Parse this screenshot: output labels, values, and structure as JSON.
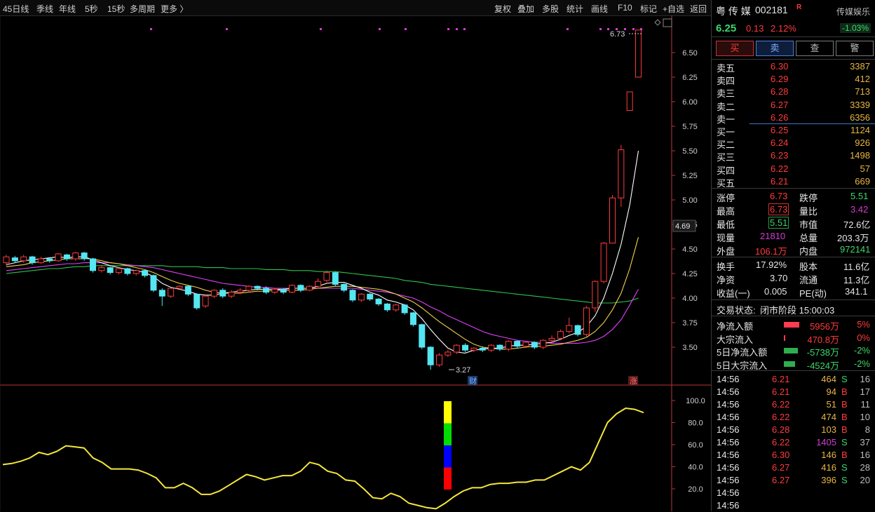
{
  "toolbar": {
    "left_items": [
      "45日线",
      "季线",
      "年线",
      "5秒",
      "15秒",
      "多周期",
      "更多 〉"
    ],
    "right_items": [
      "复权",
      "叠加",
      "多股",
      "统计",
      "画线",
      "F10",
      "标记",
      "+自选",
      "返回"
    ]
  },
  "stock": {
    "name": "粤 传 媒",
    "code": "002181",
    "badge": "R",
    "sector": "传媒娱乐",
    "sector_change": "-1.03%",
    "price": "6.25",
    "change": "0.13",
    "change_pct": "2.12%"
  },
  "trade_buttons": [
    "买",
    "卖",
    "查",
    "警"
  ],
  "orderbook": {
    "asks": [
      {
        "label": "卖五",
        "price": "6.30",
        "vol": "3387"
      },
      {
        "label": "卖四",
        "price": "6.29",
        "vol": "412"
      },
      {
        "label": "卖三",
        "price": "6.28",
        "vol": "713"
      },
      {
        "label": "卖二",
        "price": "6.27",
        "vol": "3339"
      },
      {
        "label": "卖一",
        "price": "6.26",
        "vol": "6356"
      }
    ],
    "bids": [
      {
        "label": "买一",
        "price": "6.25",
        "vol": "1124"
      },
      {
        "label": "买二",
        "price": "6.24",
        "vol": "926"
      },
      {
        "label": "买三",
        "price": "6.23",
        "vol": "1498"
      },
      {
        "label": "买四",
        "price": "6.22",
        "vol": "57"
      },
      {
        "label": "买五",
        "price": "6.21",
        "vol": "669"
      }
    ]
  },
  "stats": {
    "limit_up_l": "涨停",
    "limit_up_v": "6.73",
    "limit_down_l": "跌停",
    "limit_down_v": "5.51",
    "high_l": "最高",
    "high_v": "6.73",
    "vol_ratio_l": "量比",
    "vol_ratio_v": "3.42",
    "low_l": "最低",
    "low_v": "5.51",
    "mcap_l": "市值",
    "mcap_v": "72.6亿",
    "cur_l": "现量",
    "cur_v": "21810",
    "total_l": "总量",
    "total_v": "203.3万",
    "outer_l": "外盘",
    "outer_v": "106.1万",
    "inner_l": "内盘",
    "inner_v": "972141",
    "turnover_l": "换手",
    "turnover_v": "17.92%",
    "share_l": "股本",
    "share_v": "11.6亿",
    "nav_l": "净资",
    "nav_v": "3.70",
    "float_l": "流通",
    "float_v": "11.3亿",
    "eps_l": "收益(一)",
    "eps_v": "0.005",
    "pe_l": "PE(动)",
    "pe_v": "341.1"
  },
  "status": {
    "label": "交易状态:",
    "value": "闭市阶段 15:00:03"
  },
  "flows": [
    {
      "label": "净流入额",
      "value": "5956万",
      "pct": "5%",
      "color": "#ff3b50",
      "bar": 0.6,
      "dir": "pos"
    },
    {
      "label": "大宗流入",
      "value": "470.8万",
      "pct": "0%",
      "color": "#ff3b50",
      "bar": 0.05,
      "dir": "pos"
    },
    {
      "label": "5日净流入额",
      "value": "-5738万",
      "pct": "-2%",
      "color": "#2fae4e",
      "bar": 0.55,
      "dir": "neg"
    },
    {
      "label": "5日大宗流入",
      "value": "-4524万",
      "pct": "-2%",
      "color": "#2fae4e",
      "bar": 0.45,
      "dir": "neg"
    }
  ],
  "ticks": [
    {
      "time": "14:56",
      "price": "6.21",
      "vol": "464",
      "side": "S",
      "n": "16"
    },
    {
      "time": "14:56",
      "price": "6.21",
      "vol": "94",
      "side": "B",
      "n": "17"
    },
    {
      "time": "14:56",
      "price": "6.22",
      "vol": "51",
      "side": "B",
      "n": "11"
    },
    {
      "time": "14:56",
      "price": "6.22",
      "vol": "474",
      "side": "B",
      "n": "10"
    },
    {
      "time": "14:56",
      "price": "6.28",
      "vol": "103",
      "side": "B",
      "n": "8"
    },
    {
      "time": "14:56",
      "price": "6.22",
      "vol": "1405",
      "side": "S",
      "n": "37"
    },
    {
      "time": "14:56",
      "price": "6.30",
      "vol": "146",
      "side": "B",
      "n": "16"
    },
    {
      "time": "14:56",
      "price": "6.27",
      "vol": "416",
      "side": "S",
      "n": "28"
    },
    {
      "time": "14:56",
      "price": "6.27",
      "vol": "396",
      "side": "S",
      "n": "20"
    },
    {
      "time": "14:56",
      "price": "",
      "vol": "",
      "side": "",
      "n": ""
    },
    {
      "time": "14:56",
      "price": "",
      "vol": "",
      "side": "",
      "n": ""
    }
  ],
  "chart_data": [
    {
      "type": "candlestick",
      "yticks": [
        6.5,
        6.25,
        6.0,
        5.75,
        5.5,
        5.25,
        5.0,
        4.75,
        4.5,
        4.25,
        4.0,
        3.75,
        3.5
      ],
      "current_price_label": "4.69",
      "annotations": {
        "high": "6.73",
        "low": "3.27",
        "cai": "财",
        "zhang": "涨"
      },
      "colors": {
        "up": "#ff3b3b",
        "down": "#54e6f2",
        "ma5": "#ffffff",
        "ma10": "#f2d04b",
        "ma20": "#e040fb",
        "ma60": "#2fc24a"
      },
      "candles": [
        [
          4.36,
          4.42,
          4.33,
          4.44
        ],
        [
          4.41,
          4.38,
          4.36,
          4.43
        ],
        [
          4.38,
          4.42,
          4.36,
          4.44
        ],
        [
          4.42,
          4.36,
          4.34,
          4.43
        ],
        [
          4.36,
          4.4,
          4.35,
          4.42
        ],
        [
          4.4,
          4.38,
          4.36,
          4.41
        ],
        [
          4.38,
          4.45,
          4.37,
          4.46
        ],
        [
          4.44,
          4.4,
          4.38,
          4.45
        ],
        [
          4.4,
          4.46,
          4.38,
          4.47
        ],
        [
          4.46,
          4.4,
          4.38,
          4.47
        ],
        [
          4.4,
          4.28,
          4.26,
          4.41
        ],
        [
          4.28,
          4.31,
          4.26,
          4.33
        ],
        [
          4.31,
          4.26,
          4.24,
          4.32
        ],
        [
          4.26,
          4.3,
          4.24,
          4.31
        ],
        [
          4.3,
          4.25,
          4.23,
          4.31
        ],
        [
          4.25,
          4.28,
          4.23,
          4.29
        ],
        [
          4.28,
          4.23,
          4.21,
          4.29
        ],
        [
          4.23,
          4.08,
          4.06,
          4.24
        ],
        [
          4.08,
          4.02,
          3.92,
          4.1
        ],
        [
          4.02,
          4.1,
          4.0,
          4.11
        ],
        [
          4.1,
          4.12,
          4.08,
          4.13
        ],
        [
          4.12,
          4.04,
          4.02,
          4.13
        ],
        [
          4.04,
          3.9,
          3.88,
          4.05
        ],
        [
          3.92,
          4.02,
          3.9,
          4.04
        ],
        [
          4.02,
          4.08,
          4.0,
          4.09
        ],
        [
          4.08,
          4.02,
          4.0,
          4.1
        ],
        [
          4.02,
          4.06,
          4.0,
          4.08
        ],
        [
          4.06,
          4.08,
          4.04,
          4.1
        ],
        [
          4.08,
          4.12,
          4.06,
          4.13
        ],
        [
          4.12,
          4.1,
          4.08,
          4.13
        ],
        [
          4.1,
          4.06,
          4.04,
          4.12
        ],
        [
          4.06,
          4.09,
          4.04,
          4.1
        ],
        [
          4.09,
          4.06,
          4.04,
          4.1
        ],
        [
          4.06,
          4.13,
          4.05,
          4.14
        ],
        [
          4.13,
          4.08,
          4.06,
          4.14
        ],
        [
          4.08,
          4.12,
          4.07,
          4.13
        ],
        [
          4.12,
          4.17,
          4.1,
          4.2
        ],
        [
          4.18,
          4.26,
          4.16,
          4.28
        ],
        [
          4.26,
          4.14,
          4.12,
          4.27
        ],
        [
          4.14,
          4.08,
          4.06,
          4.15
        ],
        [
          4.08,
          3.98,
          3.96,
          4.09
        ],
        [
          3.98,
          4.04,
          3.96,
          4.05
        ],
        [
          4.04,
          3.99,
          3.97,
          4.05
        ],
        [
          3.99,
          3.94,
          3.92,
          4.0
        ],
        [
          3.94,
          3.88,
          3.86,
          3.95
        ],
        [
          3.88,
          3.93,
          3.86,
          3.94
        ],
        [
          3.93,
          3.85,
          3.83,
          3.94
        ],
        [
          3.85,
          3.73,
          3.71,
          3.86
        ],
        [
          3.73,
          3.5,
          3.48,
          3.74
        ],
        [
          3.5,
          3.32,
          3.27,
          3.51
        ],
        [
          3.32,
          3.42,
          3.3,
          3.44
        ],
        [
          3.42,
          3.45,
          3.4,
          3.47
        ],
        [
          3.45,
          3.52,
          3.43,
          3.53
        ],
        [
          3.52,
          3.47,
          3.45,
          3.54
        ],
        [
          3.47,
          3.49,
          3.45,
          3.5
        ],
        [
          3.49,
          3.47,
          3.45,
          3.51
        ],
        [
          3.47,
          3.52,
          3.45,
          3.53
        ],
        [
          3.52,
          3.48,
          3.46,
          3.53
        ],
        [
          3.48,
          3.56,
          3.46,
          3.57
        ],
        [
          3.56,
          3.51,
          3.49,
          3.57
        ],
        [
          3.51,
          3.55,
          3.49,
          3.56
        ],
        [
          3.55,
          3.5,
          3.48,
          3.56
        ],
        [
          3.5,
          3.57,
          3.48,
          3.58
        ],
        [
          3.57,
          3.59,
          3.55,
          3.62
        ],
        [
          3.59,
          3.66,
          3.57,
          3.68
        ],
        [
          3.66,
          3.72,
          3.64,
          3.8
        ],
        [
          3.72,
          3.63,
          3.61,
          3.73
        ],
        [
          3.63,
          3.9,
          3.6,
          3.92
        ],
        [
          3.9,
          4.17,
          3.86,
          4.18
        ],
        [
          4.17,
          4.56,
          4.15,
          4.57
        ],
        [
          4.56,
          5.02,
          4.82,
          5.05
        ],
        [
          5.02,
          5.51,
          4.93,
          5.56
        ],
        [
          5.91,
          6.1,
          5.91,
          6.1
        ],
        [
          6.25,
          6.73,
          6.25,
          6.73
        ]
      ],
      "ma5": [
        4.34,
        4.36,
        4.38,
        4.39,
        4.4,
        4.41,
        4.42,
        4.41,
        4.42,
        4.42,
        4.39,
        4.36,
        4.33,
        4.31,
        4.29,
        4.28,
        4.26,
        4.22,
        4.15,
        4.11,
        4.09,
        4.07,
        4.04,
        4.03,
        4.03,
        4.05,
        4.06,
        4.07,
        4.08,
        4.09,
        4.09,
        4.09,
        4.09,
        4.1,
        4.1,
        4.1,
        4.12,
        4.15,
        4.16,
        4.16,
        4.13,
        4.1,
        4.06,
        4.03,
        3.98,
        3.96,
        3.93,
        3.88,
        3.79,
        3.68,
        3.58,
        3.49,
        3.45,
        3.44,
        3.47,
        3.48,
        3.49,
        3.49,
        3.51,
        3.52,
        3.52,
        3.53,
        3.54,
        3.55,
        3.58,
        3.62,
        3.65,
        3.71,
        3.82,
        4.0,
        4.25,
        4.55,
        4.95,
        5.5
      ],
      "ma10": [
        4.32,
        4.33,
        4.34,
        4.36,
        4.37,
        4.38,
        4.39,
        4.4,
        4.4,
        4.4,
        4.4,
        4.38,
        4.36,
        4.35,
        4.33,
        4.31,
        4.29,
        4.26,
        4.22,
        4.18,
        4.15,
        4.13,
        4.11,
        4.08,
        4.06,
        4.05,
        4.05,
        4.05,
        4.06,
        4.07,
        4.07,
        4.08,
        4.08,
        4.08,
        4.08,
        4.09,
        4.1,
        4.11,
        4.12,
        4.12,
        4.12,
        4.11,
        4.1,
        4.09,
        4.07,
        4.04,
        4.0,
        3.96,
        3.9,
        3.83,
        3.76,
        3.7,
        3.64,
        3.58,
        3.53,
        3.5,
        3.49,
        3.48,
        3.48,
        3.49,
        3.5,
        3.51,
        3.51,
        3.52,
        3.53,
        3.55,
        3.57,
        3.6,
        3.66,
        3.75,
        3.88,
        4.05,
        4.3,
        4.62
      ],
      "ma20": [
        4.28,
        4.29,
        4.3,
        4.31,
        4.32,
        4.33,
        4.34,
        4.35,
        4.35,
        4.36,
        4.36,
        4.36,
        4.36,
        4.35,
        4.34,
        4.33,
        4.32,
        4.31,
        4.29,
        4.27,
        4.25,
        4.23,
        4.21,
        4.19,
        4.17,
        4.15,
        4.14,
        4.13,
        4.12,
        4.11,
        4.11,
        4.1,
        4.1,
        4.1,
        4.1,
        4.1,
        4.1,
        4.1,
        4.1,
        4.1,
        4.1,
        4.09,
        4.08,
        4.07,
        4.06,
        4.04,
        4.02,
        4.0,
        3.96,
        3.91,
        3.87,
        3.82,
        3.78,
        3.74,
        3.7,
        3.66,
        3.63,
        3.61,
        3.59,
        3.57,
        3.56,
        3.55,
        3.55,
        3.54,
        3.54,
        3.54,
        3.54,
        3.55,
        3.57,
        3.61,
        3.68,
        3.78,
        3.93,
        4.09
      ],
      "ma60": [
        4.25,
        4.26,
        4.27,
        4.28,
        4.29,
        4.3,
        4.3,
        4.31,
        4.32,
        4.32,
        4.33,
        4.33,
        4.33,
        4.33,
        4.33,
        4.33,
        4.33,
        4.33,
        4.33,
        4.32,
        4.32,
        4.32,
        4.32,
        4.31,
        4.31,
        4.31,
        4.3,
        4.3,
        4.3,
        4.3,
        4.29,
        4.29,
        4.29,
        4.28,
        4.28,
        4.28,
        4.27,
        4.27,
        4.27,
        4.26,
        4.25,
        4.24,
        4.23,
        4.22,
        4.21,
        4.2,
        4.18,
        4.17,
        4.16,
        4.14,
        4.13,
        4.12,
        4.11,
        4.1,
        4.09,
        4.08,
        4.07,
        4.06,
        4.05,
        4.04,
        4.03,
        4.02,
        4.01,
        4.0,
        3.99,
        3.98,
        3.97,
        3.96,
        3.95,
        3.95,
        3.95,
        3.96,
        3.97,
        4.0
      ]
    },
    {
      "type": "line",
      "yticks": [
        100.0,
        80.0,
        60.0,
        40.0,
        20.0
      ],
      "color": "#f5e63a",
      "values": [
        42,
        43,
        45,
        48,
        53,
        51,
        54,
        59,
        58,
        57,
        48,
        44,
        38,
        38,
        38,
        37,
        34,
        30,
        21,
        21,
        25,
        21,
        15,
        15,
        18,
        23,
        28,
        33,
        31,
        28,
        30,
        32,
        32,
        36,
        44,
        42,
        36,
        34,
        28,
        27,
        20,
        12,
        11,
        16,
        13,
        7,
        5,
        3,
        2,
        7,
        13,
        18,
        21,
        21,
        24,
        25,
        25,
        26,
        26,
        28,
        28,
        32,
        36,
        40,
        37,
        44,
        62,
        80,
        88,
        93,
        92,
        89
      ],
      "marker": {
        "colors": [
          "#ffff00",
          "#00dd00",
          "#0000ff",
          "#ff0000"
        ]
      }
    }
  ]
}
